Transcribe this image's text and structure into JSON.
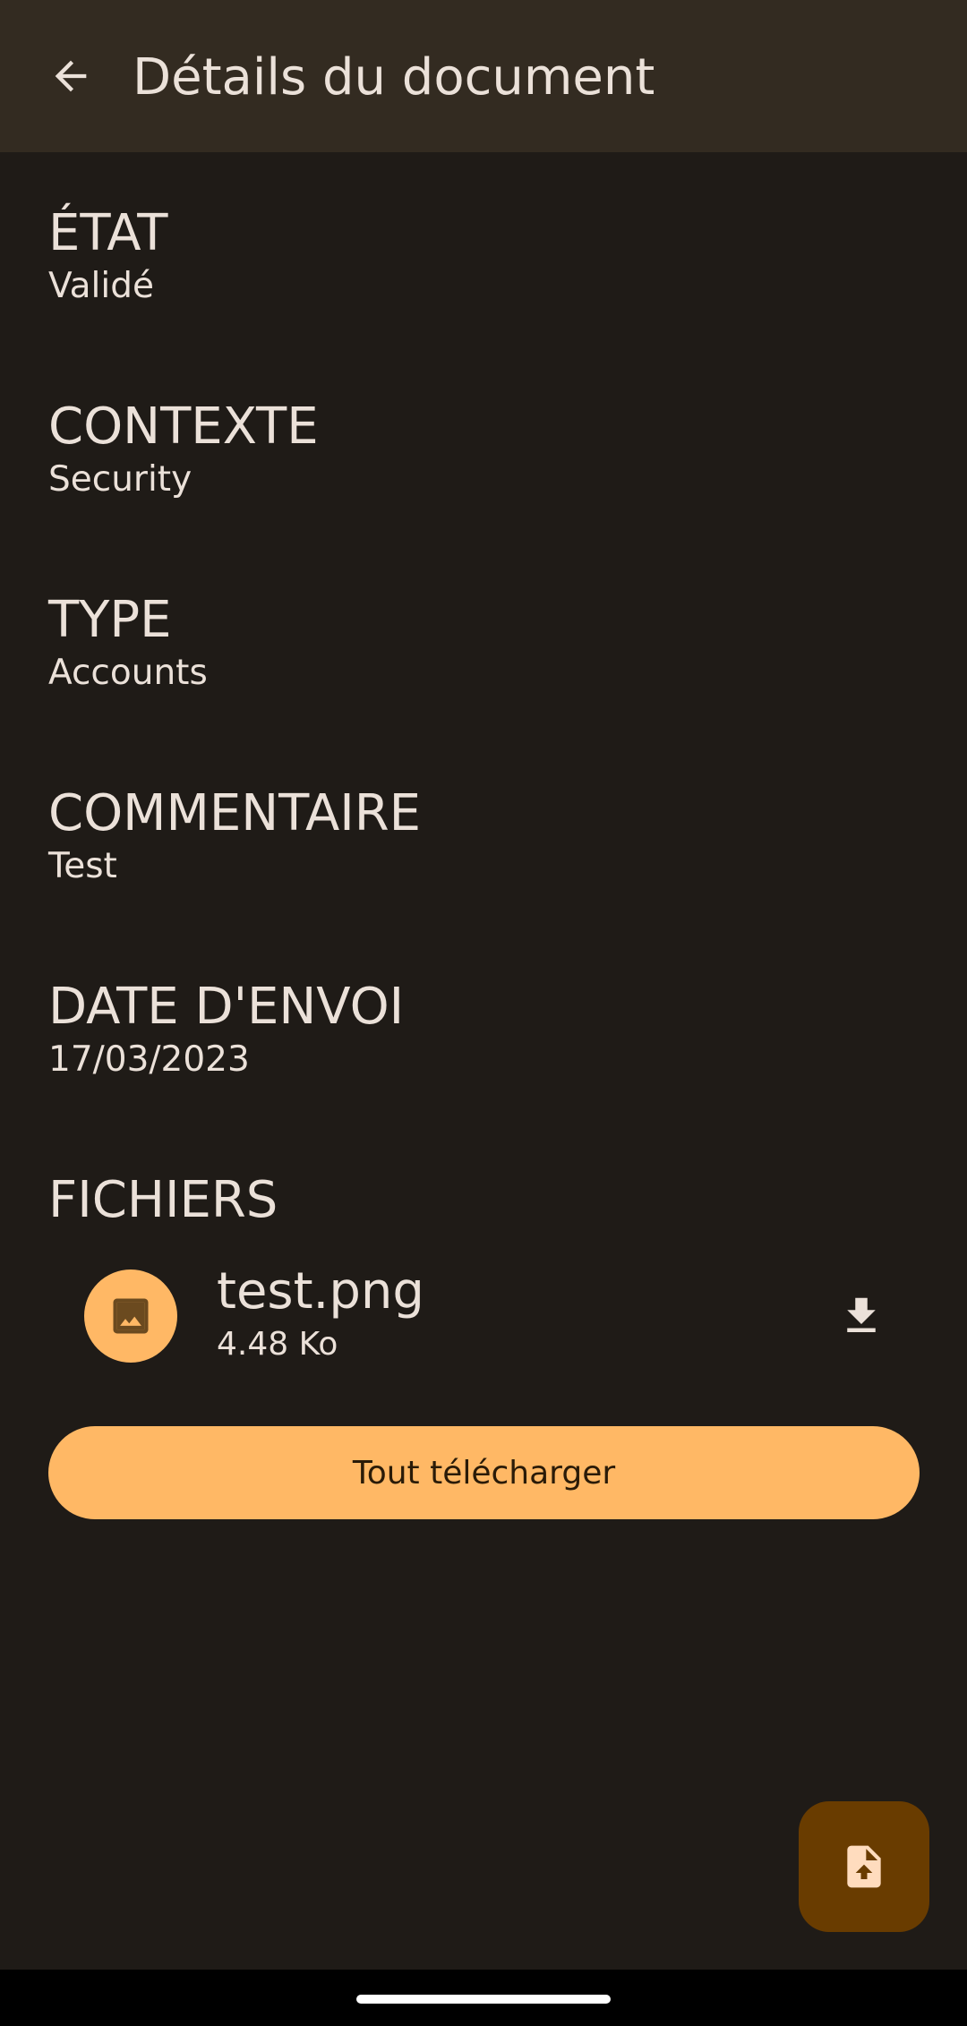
{
  "header": {
    "title": "Détails du document",
    "back_icon": "arrow-left-icon"
  },
  "fields": [
    {
      "label": "ÉTAT",
      "value": "Validé"
    },
    {
      "label": "CONTEXTE",
      "value": "Security"
    },
    {
      "label": "TYPE",
      "value": "Accounts"
    },
    {
      "label": "COMMENTAIRE",
      "value": "Test"
    },
    {
      "label": "DATE D'ENVOI",
      "value": "17/03/2023"
    }
  ],
  "files": {
    "label": "FICHIERS",
    "items": [
      {
        "name": "test.png",
        "size": "4.48 Ko",
        "icon": "image-icon",
        "action_icon": "download-icon"
      }
    ]
  },
  "download_all_label": "Tout télécharger",
  "fab_icon": "upload-file-icon",
  "colors": {
    "background": "#1f1b17",
    "topbar": "#332b21",
    "accent": "#ffb865",
    "fab": "#693c00",
    "text": "#ebe1d9"
  }
}
